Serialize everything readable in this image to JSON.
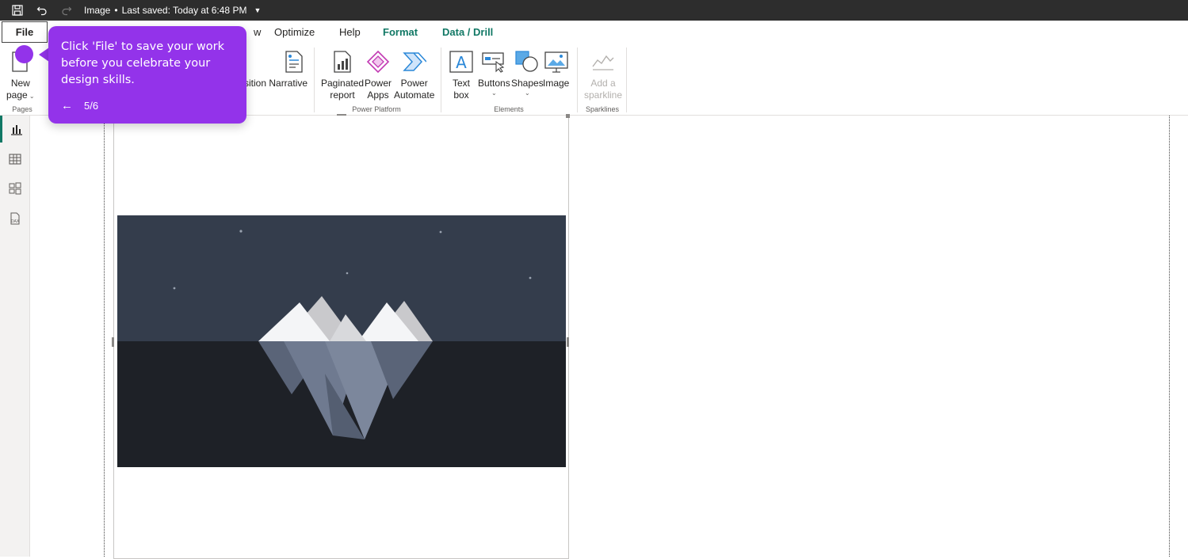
{
  "titlebar": {
    "title": "Image",
    "separator": "•",
    "saved": "Last saved: Today at 6:48 PM",
    "icons": [
      "save-icon",
      "undo-icon",
      "redo-icon",
      "caret-down-icon"
    ]
  },
  "tabs": {
    "file": "File",
    "view": "w",
    "optimize": "Optimize",
    "help": "Help",
    "format": "Format",
    "data_drill": "Data / Drill"
  },
  "ribbon": {
    "new_page": {
      "line1": "New",
      "line2": "page"
    },
    "pages_group": "Pages",
    "smart_narrative": {
      "line1": "sition Narrative"
    },
    "paginated_report": {
      "line1": "Paginated",
      "line2": "report"
    },
    "power_apps": {
      "line1": "Power",
      "line2": "Apps"
    },
    "power_automate": {
      "line1": "Power",
      "line2": "Automate"
    },
    "power_platform_group": "Power Platform",
    "text_box": {
      "line1": "Text",
      "line2": "box"
    },
    "buttons": {
      "line1": "Buttons"
    },
    "shapes": {
      "line1": "Shapes"
    },
    "image": {
      "line1": "Image"
    },
    "elements_group": "Elements",
    "sparkline": {
      "line1": "Add a",
      "line2": "sparkline"
    },
    "sparklines_group": "Sparklines"
  },
  "leftnav": {
    "items": [
      "report-view-icon",
      "table-view-icon",
      "model-view-icon",
      "dax-query-icon"
    ]
  },
  "tooltip": {
    "text": "Click 'File' to save your work before you celebrate your design skills.",
    "back": "←",
    "step": "5/6"
  },
  "colors": {
    "accent": "#117865",
    "tooltip_bg": "#9333ea",
    "titlebar_bg": "#2d2d2d"
  }
}
